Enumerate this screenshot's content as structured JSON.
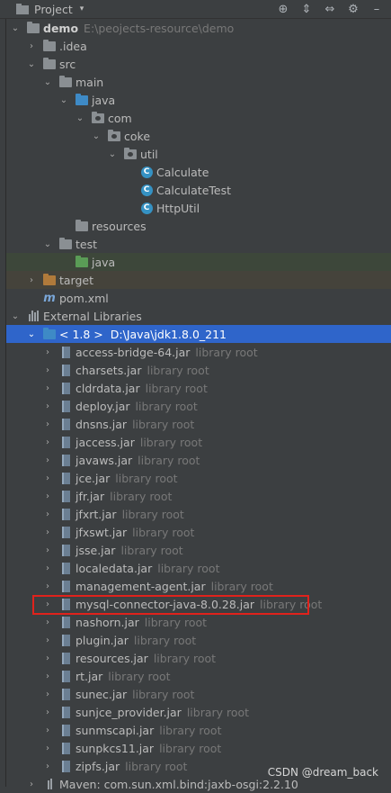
{
  "toolbar": {
    "title": "Project",
    "dropdown_arrow": "▾",
    "icons": [
      "crosshair-icon",
      "expand-icon",
      "collapse-icon",
      "gear-icon",
      "minimize-icon"
    ]
  },
  "tree": {
    "project": {
      "name": "demo",
      "path": "E:\\peojects-resource\\demo"
    },
    "idea": ".idea",
    "src": "src",
    "main": "main",
    "java": "java",
    "com": "com",
    "coke": "coke",
    "util": "util",
    "classes": [
      "Calculate",
      "CalculateTest",
      "HttpUtil"
    ],
    "resources": "resources",
    "test": "test",
    "test_java": "java",
    "target": "target",
    "pom": "pom.xml",
    "external_libraries": "External Libraries",
    "jdk": {
      "label": "< 1.8 >",
      "path": "D:\\Java\\jdk1.8.0_211"
    },
    "library_root_label": "library root",
    "jars": [
      "access-bridge-64.jar",
      "charsets.jar",
      "cldrdata.jar",
      "deploy.jar",
      "dnsns.jar",
      "jaccess.jar",
      "javaws.jar",
      "jce.jar",
      "jfr.jar",
      "jfxrt.jar",
      "jfxswt.jar",
      "jsse.jar",
      "localedata.jar",
      "management-agent.jar",
      "mysql-connector-java-8.0.28.jar",
      "nashorn.jar",
      "plugin.jar",
      "resources.jar",
      "rt.jar",
      "sunec.jar",
      "sunjce_provider.jar",
      "sunmscapi.jar",
      "sunpkcs11.jar",
      "zipfs.jar"
    ],
    "maven_partial": "Maven: com.sun.xml.bind:jaxb-osgi:2.2.10"
  },
  "watermark": "CSDN @dream_back"
}
